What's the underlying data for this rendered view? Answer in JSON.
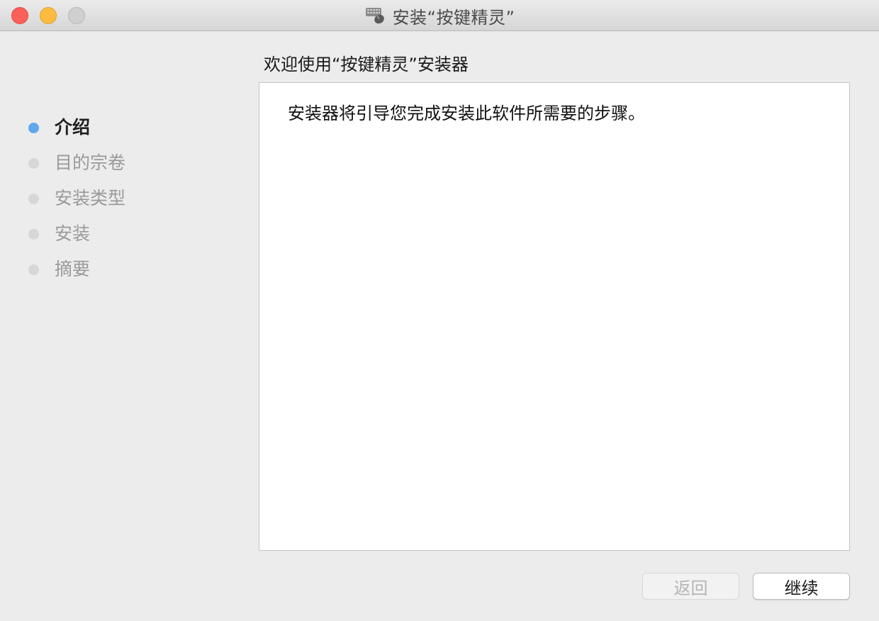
{
  "window": {
    "title": "安装“按键精灵”",
    "app_icon": "keyboard-mouse-icon"
  },
  "sidebar": {
    "steps": [
      {
        "label": "介绍",
        "active": true
      },
      {
        "label": "目的宗卷",
        "active": false
      },
      {
        "label": "安装类型",
        "active": false
      },
      {
        "label": "安装",
        "active": false
      },
      {
        "label": "摘要",
        "active": false
      }
    ]
  },
  "main": {
    "heading": "欢迎使用“按键精灵”安装器",
    "body_text": "安装器将引导您完成安装此软件所需要的步骤。"
  },
  "footer": {
    "back_label": "返回",
    "continue_label": "继续"
  },
  "colors": {
    "active_step": "#5fa8ec",
    "inactive_step": "#d7d7d7",
    "close": "#fc605b",
    "minimize": "#fdbc40",
    "zoom_disabled": "#d0d0d0"
  }
}
